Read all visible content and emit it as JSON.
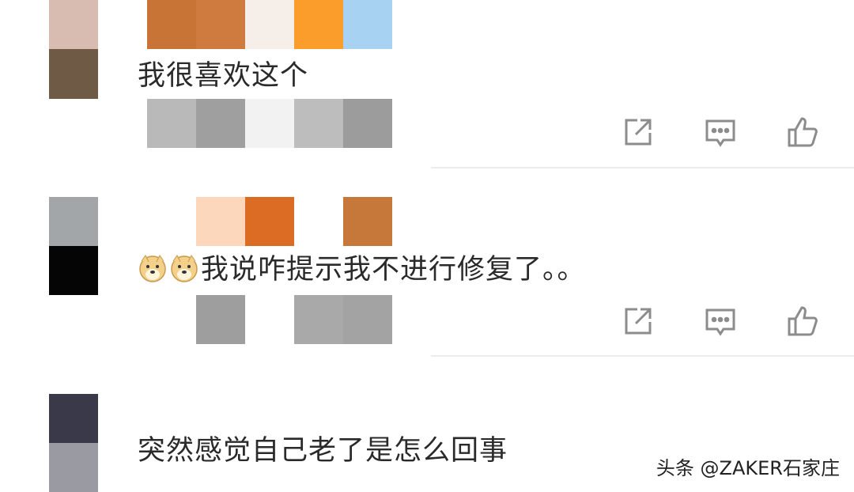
{
  "comments": [
    {
      "text": "我很喜欢这个",
      "avatar_colors": [
        "#d8bcb2",
        "#6e5a45"
      ]
    },
    {
      "text": "我说咋提示我不进行修复了。。",
      "avatar_colors": [
        "#a3a6a8",
        "#050505"
      ],
      "emoji": [
        "doge-emoji",
        "doge-emoji"
      ]
    },
    {
      "text": "突然感觉自己老了是怎么回事",
      "avatar_colors": [
        "#3a394a",
        "#9a9aa2"
      ]
    }
  ],
  "actions": {
    "share_icon": "share-icon",
    "reply_icon": "comment-icon",
    "like_icon": "thumbs-up-icon"
  },
  "watermark": "头条 @ZAKER石家庄",
  "colors": {
    "icon": "#8c8c8c",
    "divider": "#ececec"
  }
}
